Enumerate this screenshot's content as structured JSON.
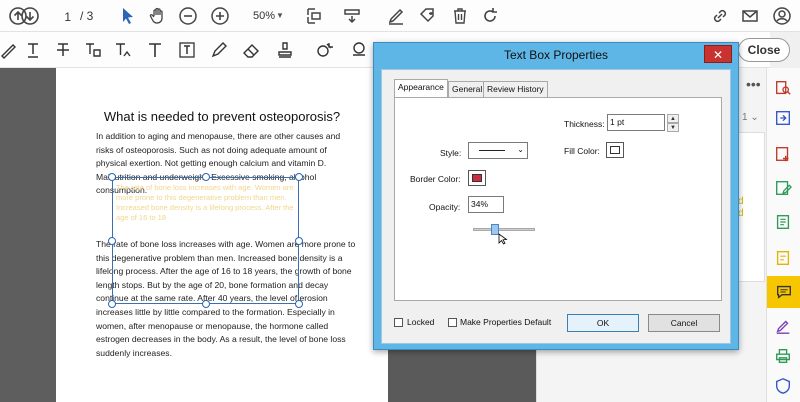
{
  "toolbar": {
    "page_current": "1",
    "page_total": "/ 3",
    "zoom": "50%",
    "close_label": "Close"
  },
  "document": {
    "title": "What is needed to prevent osteoporosis?",
    "paragraph1_a": "In addition to aging and menopause, there are other causes and risks of osteoporosis. Such as not doing adequate amount of physical exertion. Not getting enough calcium and vitamin D. Ma",
    "paragraph1_strike": "lnutrition and underweight. Excessive smoking",
    "paragraph1_b": ", alcohol consumption.",
    "paragraph2": "The rate of bone loss increases with age. Women are more prone to this degenerative problem than men. Increased bone density is a lifelong process. After the age of 16 to 18 years, the growth of bone length stops. But by the age of 20, bone formation and decay continue at the same rate. After 40 years, the level of erosion increases little by little compared to the formation. Especially in women, after menopause or menopause, the hormone called estrogen decreases in the body. As a result, the level of bone loss suddenly increases.",
    "ghost_text": "The rate of bone loss increases with age. Women are more prone to this degenerative problem than men. Increased bone density is a lifelong process. After the age of 16 to 18"
  },
  "right_panel": {
    "dots": "•••",
    "num": "1 ⌄",
    "yellow_text": "d\nd"
  },
  "dialog": {
    "title": "Text Box Properties",
    "close": "✕",
    "tabs": [
      "Appearance",
      "General",
      "Review History"
    ],
    "thickness_label": "Thickness:",
    "thickness_value": "1 pt",
    "style_label": "Style:",
    "fill_color_label": "Fill Color:",
    "border_color_label": "Border Color:",
    "opacity_label": "Opacity:",
    "opacity_value": "34%",
    "locked_label": "Locked",
    "make_default_label": "Make Properties Default",
    "ok_label": "OK",
    "cancel_label": "Cancel"
  },
  "colors": {
    "border_color": "#d12b43",
    "fill_color": "#ffffff",
    "dialog_frame": "#5eb6e6",
    "rail_active": "#f6c700"
  },
  "icons": {
    "top": [
      "arrow-down-icon",
      "cursor-icon",
      "hand-icon",
      "zoom-out-icon",
      "zoom-in-icon",
      "fit-page-icon",
      "scroll-icon",
      "sign-icon",
      "stamp-icon",
      "delete-icon",
      "rotate-icon",
      "link-icon",
      "mail-icon",
      "account-icon"
    ],
    "rail": [
      "search-icon",
      "export-pdf-icon",
      "create-pdf-icon",
      "edit-pdf-icon",
      "comment-icon",
      "fill-sign-icon",
      "print-icon",
      "protect-icon"
    ]
  }
}
